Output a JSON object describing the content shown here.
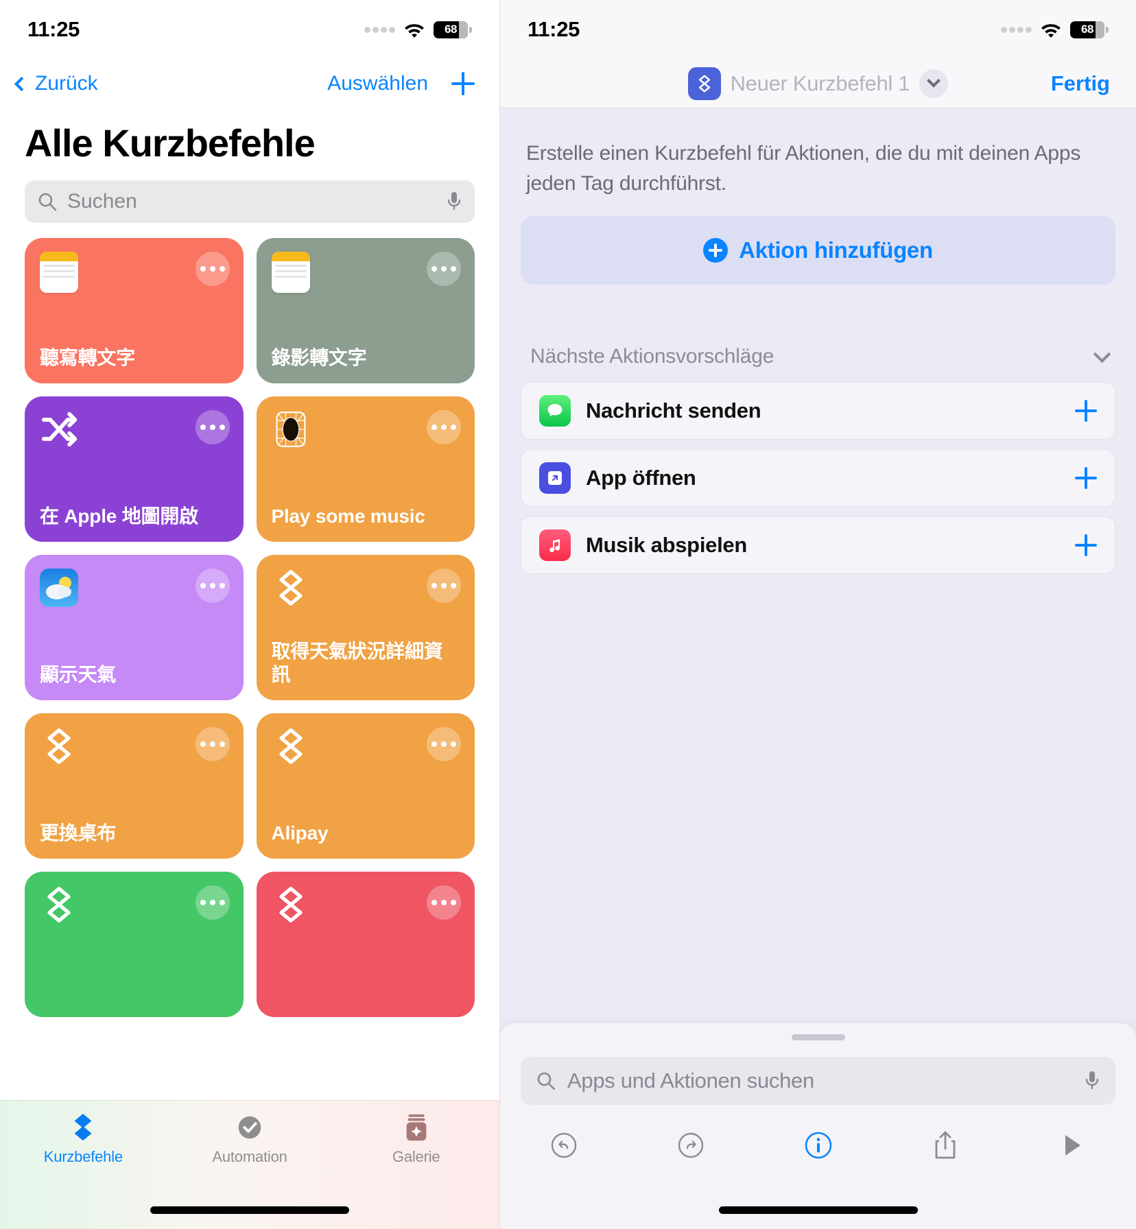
{
  "left": {
    "status": {
      "time": "11:25",
      "battery": "68",
      "wifi_icon": "wifi-icon",
      "cellular_icon": "cellular-dots-icon"
    },
    "nav": {
      "back_label": "Zurück",
      "select_label": "Auswählen",
      "add_icon": "plus-icon"
    },
    "title": "Alle Kurzbefehle",
    "search": {
      "placeholder": "Suchen",
      "search_icon": "search-icon",
      "mic_icon": "microphone-icon"
    },
    "shortcuts": [
      {
        "label": "聽寫轉文字",
        "color": "#fa7561",
        "icon": "notes-app-icon"
      },
      {
        "label": "錄影轉文字",
        "color": "#8c9e90",
        "icon": "notes-app-icon"
      },
      {
        "label": "在 Apple 地圖開啟",
        "color": "#8b42d4",
        "icon": "shuffle-icon"
      },
      {
        "label": "Play some music",
        "color": "#f0a244",
        "icon": "music-grid-icon"
      },
      {
        "label": "顯示天氣",
        "color": "#c58af6",
        "icon": "weather-app-icon"
      },
      {
        "label": "取得天氣狀況詳細資訊",
        "color": "#f0a244",
        "icon": "shortcuts-glyph-icon"
      },
      {
        "label": "更換桌布",
        "color": "#f0a244",
        "icon": "shortcuts-glyph-icon"
      },
      {
        "label": "Alipay",
        "color": "#f0a244",
        "icon": "shortcuts-glyph-icon"
      },
      {
        "label": "",
        "color": "#44c767",
        "icon": "shortcuts-glyph-icon"
      },
      {
        "label": "",
        "color": "#ef5563",
        "icon": "shortcuts-glyph-icon"
      }
    ],
    "tabs": [
      {
        "label": "Kurzbefehle",
        "icon": "shortcuts-tab-icon",
        "active": true
      },
      {
        "label": "Automation",
        "icon": "automation-tab-icon",
        "active": false
      },
      {
        "label": "Galerie",
        "icon": "gallery-tab-icon",
        "active": false
      }
    ]
  },
  "right": {
    "status": {
      "time": "11:25",
      "battery": "68",
      "wifi_icon": "wifi-icon",
      "cellular_icon": "cellular-dots-icon"
    },
    "nav": {
      "shortcut_name": "Neuer Kurzbefehl 1",
      "done_label": "Fertig",
      "chevron_icon": "chevron-down-icon",
      "badge_icon": "shortcuts-glyph-icon"
    },
    "description": "Erstelle einen Kurzbefehl für Aktionen, die du mit deinen Apps jeden Tag durchführst.",
    "add_action_label": "Aktion hinzufügen",
    "suggestions_header": "Nächste Aktionsvorschläge",
    "suggestions": [
      {
        "label": "Nachricht senden",
        "icon": "messages-app-icon",
        "color": "#34c759"
      },
      {
        "label": "App öffnen",
        "icon": "open-app-icon",
        "color": "#4a4ee0"
      },
      {
        "label": "Musik abspielen",
        "icon": "music-app-icon",
        "color": "#fa2d48"
      }
    ],
    "search": {
      "placeholder": "Apps und Aktionen suchen",
      "search_icon": "search-icon",
      "mic_icon": "microphone-icon"
    },
    "toolbar": [
      {
        "icon": "undo-icon",
        "active": false
      },
      {
        "icon": "redo-icon",
        "active": false
      },
      {
        "icon": "info-icon",
        "active": true
      },
      {
        "icon": "share-icon",
        "active": false
      },
      {
        "icon": "play-icon",
        "active": false
      }
    ]
  },
  "colors": {
    "accent": "#0a84ff",
    "add_action_bg": "#dcdef4",
    "right_bg": "#eceaf4"
  }
}
